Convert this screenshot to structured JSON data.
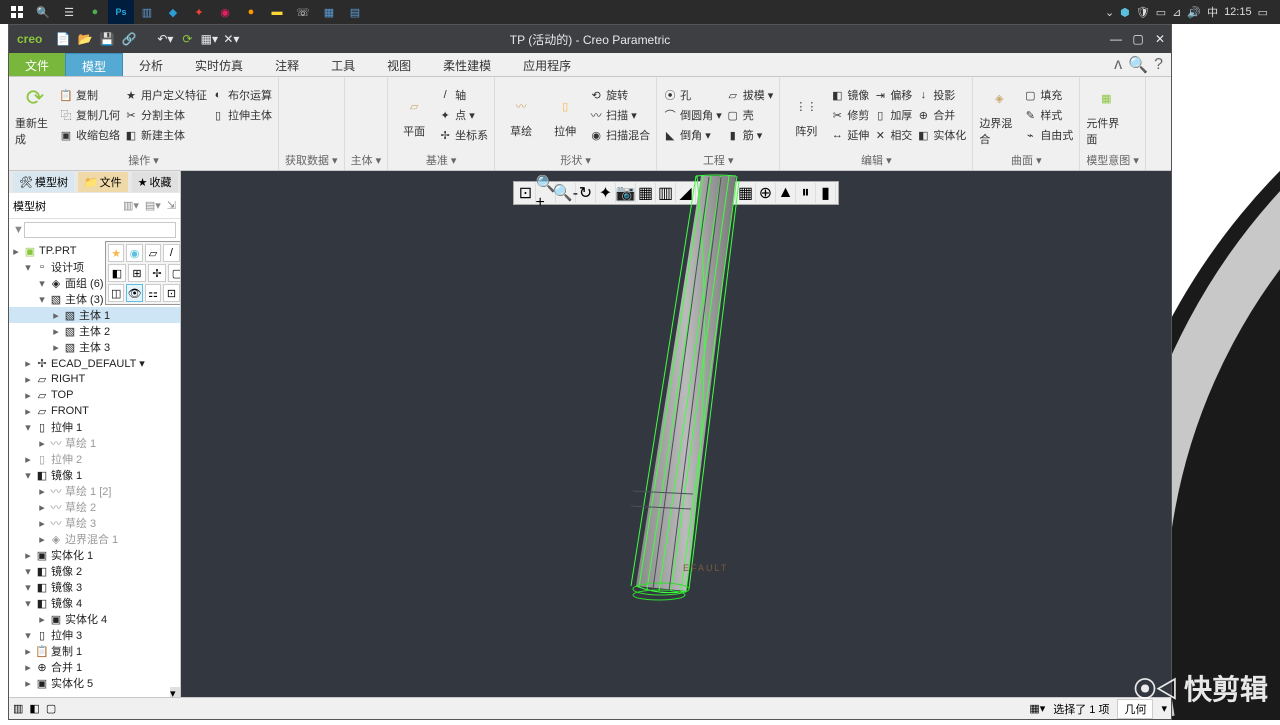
{
  "os": {
    "clock": "12:15",
    "ime": "中"
  },
  "app": {
    "title": "TP (活动的) - Creo Parametric",
    "logo": "creo"
  },
  "menu": {
    "file": "文件",
    "tabs": [
      "模型",
      "分析",
      "实时仿真",
      "注释",
      "工具",
      "视图",
      "柔性建模",
      "应用程序"
    ],
    "active_index": 0
  },
  "ribbon": {
    "groups": [
      {
        "label": "操作 ▾",
        "big": [
          {
            "name": "重新生成",
            "i": "regen"
          }
        ],
        "small": [
          [
            " 复制",
            " 复制几何",
            " 收缩包络"
          ],
          [
            " 用户定义特征",
            " 分割主体",
            " 新建主体"
          ],
          [
            " 布尔运算",
            " 拉伸主体",
            "　"
          ]
        ]
      },
      {
        "label": "获取数据 ▾"
      },
      {
        "label": "主体 ▾"
      },
      {
        "label": "基准 ▾",
        "big": [
          {
            "name": "平面",
            "i": "plane"
          }
        ],
        "small": [
          [
            " 轴",
            " 点 ▾",
            " 坐标系"
          ]
        ]
      },
      {
        "label": "形状 ▾",
        "big": [
          {
            "name": "草绘",
            "i": "sketch"
          },
          {
            "name": "拉伸",
            "i": "extrude"
          }
        ],
        "small": [
          [
            " 旋转",
            " 扫描 ▾",
            " 扫描混合"
          ]
        ]
      },
      {
        "label": "工程 ▾",
        "small": [
          [
            " 孔",
            " 倒圆角 ▾",
            " 倒角 ▾"
          ],
          [
            " 拔模 ▾",
            " 壳",
            " 筋 ▾"
          ]
        ]
      },
      {
        "label": "编辑 ▾",
        "big": [
          {
            "name": "阵列",
            "i": "pattern"
          }
        ],
        "small": [
          [
            " 镜像",
            " 修剪",
            " 延伸"
          ],
          [
            " 偏移",
            " 加厚",
            " 相交"
          ],
          [
            " 投影",
            " 合并",
            " 实体化"
          ]
        ]
      },
      {
        "label": "曲面 ▾",
        "big": [
          {
            "name": "边界混合",
            "i": "boundary"
          }
        ],
        "small": [
          [
            " 填充",
            " 样式",
            " 自由式"
          ]
        ]
      },
      {
        "label": "模型意图 ▾",
        "big": [
          {
            "name": "元件界面",
            "i": "compui"
          }
        ]
      }
    ]
  },
  "sidebar": {
    "tabs": [
      "模型树",
      "文件",
      "收藏"
    ],
    "head": "模型树",
    "root": "TP.PRT",
    "tree": [
      {
        "t": "设计项",
        "e": true,
        "lvl": 1
      },
      {
        "t": "面组 (6)",
        "lvl": 2,
        "e": true,
        "i": "quilt"
      },
      {
        "t": "主体 (3)",
        "lvl": 2,
        "e": true,
        "i": "body"
      },
      {
        "t": "主体 1",
        "lvl": 3,
        "sel": true,
        "i": "body"
      },
      {
        "t": "主体 2",
        "lvl": 3,
        "i": "body"
      },
      {
        "t": "主体 3",
        "lvl": 3,
        "i": "body"
      },
      {
        "t": "ECAD_DEFAULT ▾",
        "lvl": 1,
        "i": "csys"
      },
      {
        "t": "RIGHT",
        "lvl": 1,
        "i": "plane"
      },
      {
        "t": "TOP",
        "lvl": 1,
        "i": "plane"
      },
      {
        "t": "FRONT",
        "lvl": 1,
        "i": "plane"
      },
      {
        "t": "拉伸 1",
        "lvl": 1,
        "e": true,
        "i": "ext"
      },
      {
        "t": "草绘 1",
        "lvl": 2,
        "dim": true,
        "i": "sk"
      },
      {
        "t": "拉伸 2",
        "lvl": 1,
        "dim": true,
        "i": "ext"
      },
      {
        "t": "镜像 1",
        "lvl": 1,
        "e": true,
        "i": "mir"
      },
      {
        "t": "草绘 1 [2]",
        "lvl": 2,
        "dim": true,
        "i": "sk"
      },
      {
        "t": "草绘 2",
        "lvl": 2,
        "dim": true,
        "i": "sk"
      },
      {
        "t": "草绘 3",
        "lvl": 2,
        "dim": true,
        "i": "sk"
      },
      {
        "t": "边界混合 1",
        "lvl": 2,
        "dim": true,
        "i": "bnd"
      },
      {
        "t": "实体化 1",
        "lvl": 1,
        "i": "sol"
      },
      {
        "t": "镜像 2",
        "lvl": 1,
        "e": true,
        "i": "mir"
      },
      {
        "t": "镜像 3",
        "lvl": 1,
        "e": true,
        "i": "mir"
      },
      {
        "t": "镜像 4",
        "lvl": 1,
        "e": true,
        "i": "mir"
      },
      {
        "t": "实体化 4",
        "lvl": 2,
        "i": "sol"
      },
      {
        "t": "拉伸 3",
        "lvl": 1,
        "e": true,
        "i": "ext"
      },
      {
        "t": "复制 1",
        "lvl": 1,
        "i": "cpy"
      },
      {
        "t": "合并 1",
        "lvl": 1,
        "i": "mrg"
      },
      {
        "t": "实体化 5",
        "lvl": 1,
        "i": "sol"
      }
    ]
  },
  "viewport": {
    "label": "EFAULT"
  },
  "status": {
    "selection": "选择了 1 项",
    "filter": "几何"
  },
  "watermark": "快剪辑"
}
